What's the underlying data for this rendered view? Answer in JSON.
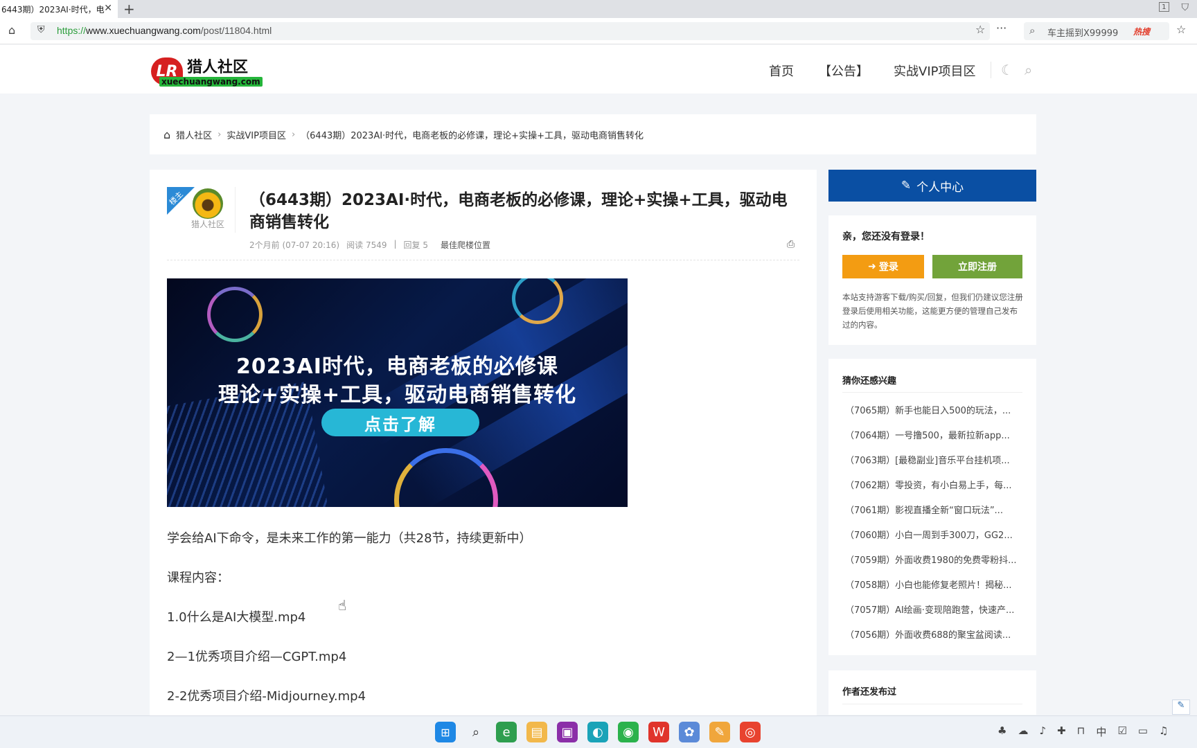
{
  "browser": {
    "tab_title": "6443期）2023AI·时代，电",
    "tab_close": "✕",
    "new_tab": "+",
    "url_protocol": "https://",
    "url_host": "www.xuechuangwang.com",
    "url_path": "/post/11804.html",
    "search_text": "车主摇到X99999",
    "search_hot": "热搜",
    "page_badge": "1"
  },
  "site": {
    "logo_mark": "LR",
    "logo_name": "猎人社区",
    "logo_domain": "xuechuangwang.com",
    "nav": [
      "首页",
      "【公告】",
      "实战VIP项目区"
    ]
  },
  "breadcrumb": {
    "home": "猎人社区",
    "section": "实战VIP项目区",
    "current": "（6443期）2023AI·时代，电商老板的必修课，理论+实操+工具，驱动电商销售转化"
  },
  "article": {
    "ribbon": "楼主",
    "author": "猎人社区",
    "title": "（6443期）2023AI·时代，电商老板的必修课，理论+实操+工具，驱动电商销售转化",
    "meta": {
      "time": "2个月前 (07-07 20:16)",
      "read_label": "阅读",
      "read_count": "7549",
      "reply_label": "回复",
      "reply_count": "5",
      "best_floor": "最佳爬楼位置"
    },
    "banner": {
      "line1": "2023AI时代，电商老板的必修课",
      "line2": "理论+实操+工具，驱动电商销售转化",
      "button": "点击了解"
    },
    "paragraphs": [
      "学会给AI下命令，是未来工作的第一能力（共28节，持续更新中）",
      "课程内容：",
      "1.0什么是AI大模型.mp4",
      "2—1优秀项目介绍—CGPT.mp4",
      "2-2优秀项目介绍-Midjourney.mp4"
    ]
  },
  "sidebar": {
    "user_center": "个人中心",
    "greeting": "亲，您还没有登录！",
    "login": "登录",
    "register": "立即注册",
    "note": "本站支持游客下载/购买/回复，但我们仍建议您注册登录后使用相关功能，这能更方便的管理自己发布过的内容。",
    "recommend_title": "猜你还感兴趣",
    "recommend": [
      "（7065期）新手也能日入500的玩法，...",
      "（7064期）一号撸500，最新拉新app...",
      "（7063期）[最稳副业]音乐平台挂机项...",
      "（7062期）零投资，有小白易上手，每...",
      "（7061期）影视直播全新“窗口玩法”...",
      "（7060期）小白一周到手300刀，GG2...",
      "（7059期）外面收费1980的免费零粉抖...",
      "（7058期）小白也能修复老照片！揭秘...",
      "（7057期）AI绘画·变现陪跑营，快速产...",
      "（7056期）外面收费688的聚宝盆阅读..."
    ],
    "author_posts_title": "作者还发布过"
  },
  "colors": {
    "primary": "#0a4fa3",
    "login": "#f39c12",
    "register": "#72a33a",
    "logo_red": "#d62020"
  }
}
